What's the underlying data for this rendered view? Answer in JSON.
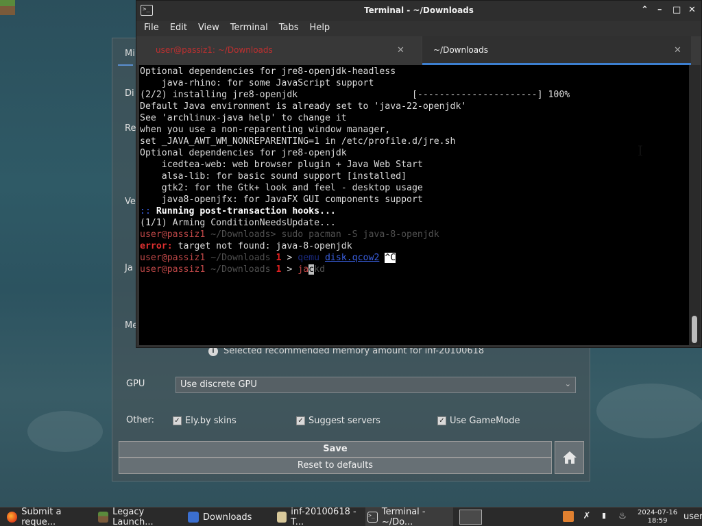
{
  "launcher": {
    "tab_label": "Mi",
    "side_labels": [
      "Di",
      "Re",
      "Ve",
      "Ja",
      "Me"
    ],
    "memory_note": "Selected recommended memory amount for inf-20100618",
    "gpu_label": "GPU",
    "gpu_value": "Use discrete GPU",
    "other_label": "Other:",
    "options": [
      {
        "label": "Ely.by skins",
        "checked": true
      },
      {
        "label": "Suggest servers",
        "checked": true
      },
      {
        "label": "Use GameMode",
        "checked": true
      }
    ],
    "save_label": "Save",
    "reset_label": "Reset to defaults"
  },
  "terminal": {
    "title": "Terminal - ~/Downloads",
    "menu": [
      "File",
      "Edit",
      "View",
      "Terminal",
      "Tabs",
      "Help"
    ],
    "tabs": [
      {
        "label": "user@passiz1: ~/Downloads",
        "active": false
      },
      {
        "label": "~/Downloads",
        "active": true
      }
    ],
    "lines": {
      "l1": "Optional dependencies for jre8-openjdk-headless",
      "l2": "    java-rhino: for some JavaScript support",
      "l3": "(2/2) installing jre8-openjdk                     [----------------------] 100%",
      "l4": "Default Java environment is already set to 'java-22-openjdk'",
      "l5": "See 'archlinux-java help' to change it",
      "l6": "when you use a non-reparenting window manager,",
      "l7": "set _JAVA_AWT_WM_NONREPARENTING=1 in /etc/profile.d/jre.sh",
      "l8": "Optional dependencies for jre8-openjdk",
      "l9": "    icedtea-web: web browser plugin + Java Web Start",
      "l10": "    alsa-lib: for basic sound support [installed]",
      "l11": "    gtk2: for the Gtk+ look and feel - desktop usage",
      "l12": "    java8-openjfx: for JavaFX GUI components support",
      "l13_prefix": "::",
      "l13_text": " Running post-transaction hooks...",
      "l14": "(1/1) Arming ConditionNeedsUpdate...",
      "l15_prompt": "user@passiz1",
      "l15_dir": " ~/Downloads>",
      "l15_cmd": " sudo pacman -S java-8-openjdk",
      "l16_err": "error:",
      "l16_text": " target not found: java-8-openjdk",
      "l17_prompt": "user@passiz1",
      "l17_dir": " ~/Downloads ",
      "l17_num": "1",
      "l17_arrow": " > ",
      "l17_cmd": "qemu ",
      "l17_file": "disk.qcow2",
      "l17_ctrl": "^C",
      "l18_prompt": "user@passiz1",
      "l18_dir": " ~/Downloads ",
      "l18_num": "1",
      "l18_arrow": " > ",
      "l18_a": "ja",
      "l18_cur": "c",
      "l18_b": "kd"
    }
  },
  "taskbar": {
    "items": [
      {
        "label": "Submit a reque...",
        "icon": "firefox-icon"
      },
      {
        "label": "Legacy Launch...",
        "icon": "minecraft-icon"
      },
      {
        "label": "Downloads",
        "icon": "files-icon"
      },
      {
        "label": "inf-20100618 - T...",
        "icon": "folder-icon"
      },
      {
        "label": "Terminal - ~/Do...",
        "icon": "terminal-icon"
      }
    ],
    "date": "2024-07-16",
    "time": "18:59",
    "user": "user"
  }
}
